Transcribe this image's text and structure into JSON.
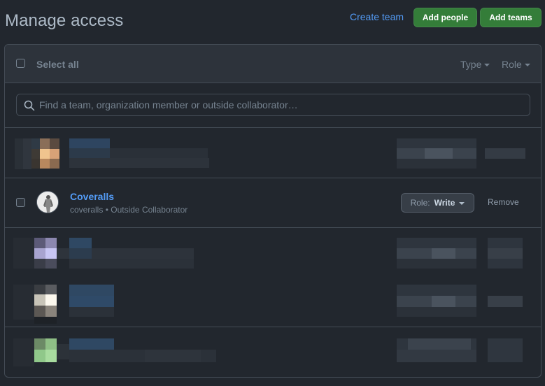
{
  "header": {
    "title": "Manage access",
    "create_team": "Create team",
    "add_people": "Add people",
    "add_teams": "Add teams"
  },
  "toolbar": {
    "select_all": "Select all",
    "type_filter": "Type",
    "role_filter": "Role"
  },
  "search": {
    "placeholder": "Find a team, organization member or outside collaborator…"
  },
  "members": [
    {
      "name": "Coveralls",
      "username": "coveralls",
      "separator": "•",
      "kind": "Outside Collaborator",
      "role_prefix": "Role:",
      "role": "Write",
      "remove": "Remove"
    }
  ],
  "colors": {
    "background": "#22272e",
    "header_bg": "#2d333b",
    "border": "#444c56",
    "link": "#539bf5",
    "primary_button": "#347d39"
  }
}
